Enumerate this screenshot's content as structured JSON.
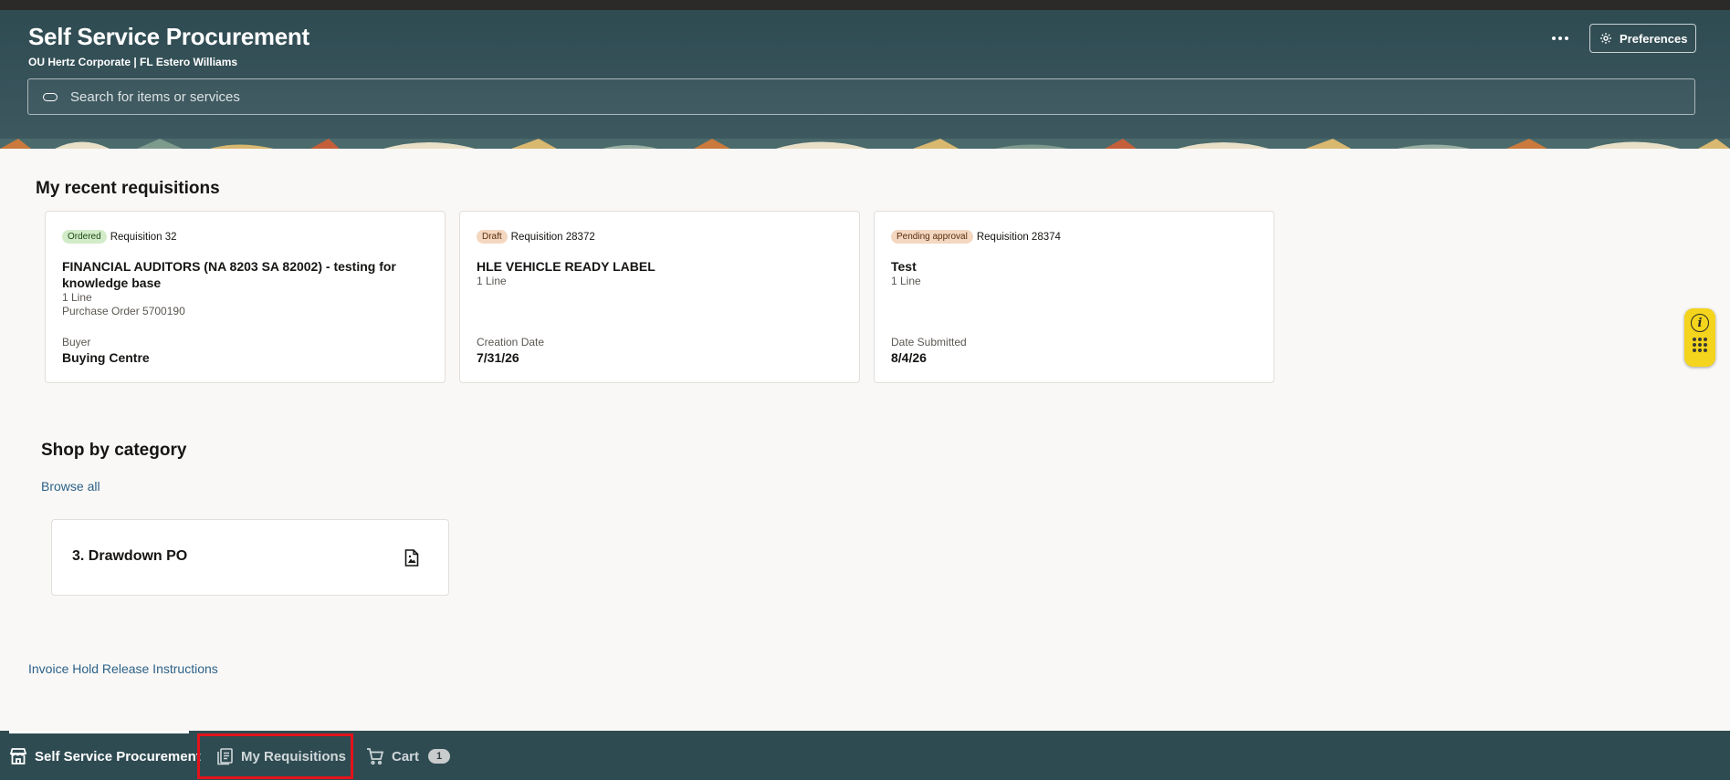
{
  "header": {
    "title": "Self Service Procurement",
    "subtitle": "OU Hertz Corporate | FL Estero Williams",
    "more_icon": "ellipsis-icon",
    "preferences_label": "Preferences",
    "search_placeholder": "Search for items or services"
  },
  "recent": {
    "title": "My recent requisitions",
    "cards": [
      {
        "status": "Ordered",
        "requisition": "Requisition 32",
        "title": "FINANCIAL AUDITORS (NA 8203 SA 82002) - testing for knowledge base",
        "lines": "1 Line",
        "extra": "Purchase Order 5700190",
        "foot_label": "Buyer",
        "foot_value": "Buying Centre"
      },
      {
        "status": "Draft",
        "requisition": "Requisition 28372",
        "title": "HLE VEHICLE READY LABEL",
        "lines": "1 Line",
        "foot_label": "Creation Date",
        "foot_value": "7/31/26"
      },
      {
        "status": "Pending approval",
        "requisition": "Requisition 28374",
        "title": "Test",
        "lines": "1 Line",
        "foot_label": "Date Submitted",
        "foot_value": "8/4/26"
      }
    ]
  },
  "shop": {
    "title": "Shop by category",
    "browse_all": "Browse all",
    "categories": [
      {
        "name": "3. Drawdown PO",
        "icon": "document-image-icon"
      }
    ]
  },
  "links": {
    "invoice_hold": "Invoice Hold Release Instructions"
  },
  "bottom_nav": {
    "items": [
      {
        "label": "Self Service Procurement",
        "icon": "store-icon",
        "active": true
      },
      {
        "label": "My Requisitions",
        "icon": "requisitions-icon",
        "active": false
      },
      {
        "label": "Cart",
        "icon": "cart-icon",
        "active": false,
        "count": "1"
      }
    ]
  },
  "helper": {
    "icon": "info-icon"
  },
  "colors": {
    "header_bg": "#2f4b52",
    "link": "#2d6188",
    "ordered_badge": "#d2ebc8",
    "draft_badge": "#f3d7c0",
    "highlight": "#e3131b",
    "helper_bg": "#f4d41c"
  }
}
